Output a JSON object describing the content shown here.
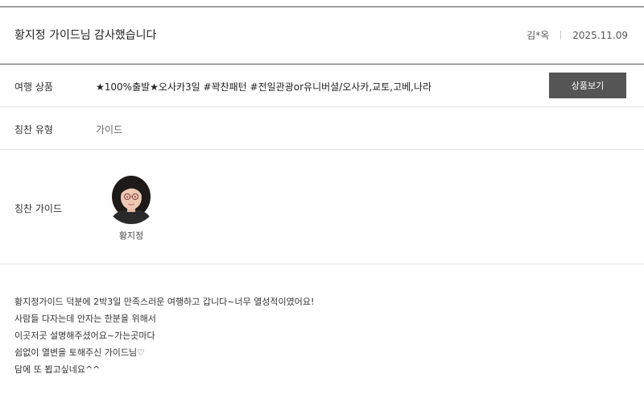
{
  "header": {
    "title": "황지정 가이드님 감사했습니다",
    "author": "김*옥",
    "date": "2025.11.09"
  },
  "product": {
    "label": "여행 상품",
    "value": "★100%출발★오사카3일 #꽉찬패턴 #전일관광or유니버셜/오사카,교토,고베,나라",
    "button_label": "상품보기"
  },
  "praise_type": {
    "label": "칭찬 유형",
    "value": "가이드"
  },
  "praise_guide": {
    "label": "칭찬 가이드",
    "name": "황지정"
  },
  "review": {
    "lines": [
      "황지정가이드 덕분에 2박3일 만족스러운 여행하고 갑니다~너무 열성적이였어요!",
      "사람들 다자는데 안자는 한분을 위해서",
      "이곳저곳 설명해주셨어요~가는곳마다",
      "쉼없이 열변을 토해주신 가이드님♡",
      "담에 또 뵙고싶네요^^"
    ]
  }
}
